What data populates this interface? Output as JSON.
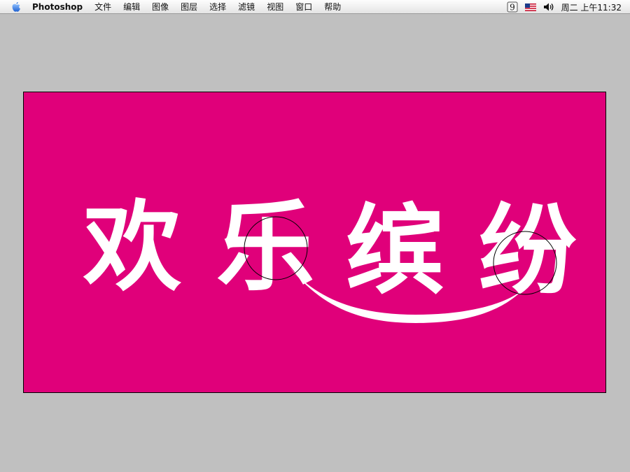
{
  "menubar": {
    "app_name": "Photoshop",
    "menus": [
      "文件",
      "编辑",
      "图像",
      "图层",
      "选择",
      "滤镜",
      "视图",
      "窗口",
      "帮助"
    ],
    "extras": {
      "palette_icon": "palette-9-icon",
      "flag_icon": "us-flag-icon",
      "volume_icon": "volume-icon",
      "clock": "周二 上午11:32"
    }
  },
  "document": {
    "background_color": "#e0007a",
    "text_color": "#ffffff",
    "characters": [
      "欢",
      "乐",
      "缤",
      "纷"
    ]
  }
}
